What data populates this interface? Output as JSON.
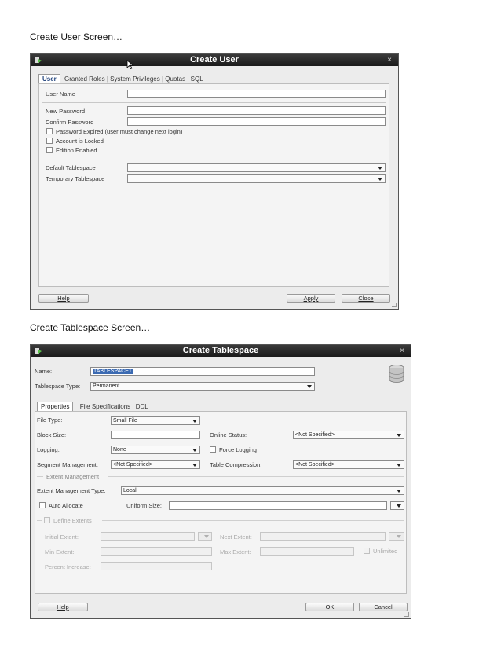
{
  "captions": {
    "first": "Create User Screen…",
    "second": "Create Tablespace Screen…"
  },
  "create_user": {
    "title": "Create User",
    "close": "×",
    "tabs": [
      "User",
      "Granted Roles",
      "System Privileges",
      "Quotas",
      "SQL"
    ],
    "labels": {
      "user_name": "User Name",
      "new_password": "New Password",
      "confirm_password": "Confirm Password",
      "password_expired": "Password Expired (user must change next login)",
      "account_locked": "Account is Locked",
      "edition_enabled": "Edition Enabled",
      "default_tablespace": "Default Tablespace",
      "temporary_tablespace": "Temporary Tablespace"
    },
    "buttons": {
      "help": "Help",
      "apply": "Apply",
      "close": "Close"
    }
  },
  "create_tablespace": {
    "title": "Create Tablespace",
    "close": "×",
    "name_label": "Name:",
    "name_value": "TABLESPACE1",
    "type_label": "Tablespace Type:",
    "type_value": "Permanent",
    "tabs": [
      "Properties",
      "File Specifications",
      "DDL"
    ],
    "props": {
      "file_type_label": "File Type:",
      "file_type_value": "Small File",
      "block_size_label": "Block Size:",
      "online_status_label": "Online Status:",
      "online_status_value": "<Not Specified>",
      "logging_label": "Logging:",
      "logging_value": "None",
      "force_logging_label": "Force Logging",
      "segment_label": "Segment Management:",
      "segment_value": "<Not Specified>",
      "compression_label": "Table Compression:",
      "compression_value": "<Not Specified>",
      "extent_mgmt_group": "Extent Management",
      "extent_type_label": "Extent Management Type:",
      "extent_type_value": "Local",
      "auto_allocate_label": "Auto Allocate",
      "uniform_size_label": "Uniform Size:",
      "define_extents_label": "Define Extents",
      "initial_extent_label": "Initial Extent:",
      "next_extent_label": "Next Extent:",
      "min_extent_label": "Min Extent:",
      "max_extent_label": "Max Extent:",
      "unlimited_label": "Unlimited",
      "percent_increase_label": "Percent Increase:"
    },
    "buttons": {
      "help": "Help",
      "ok": "OK",
      "cancel": "Cancel"
    }
  }
}
